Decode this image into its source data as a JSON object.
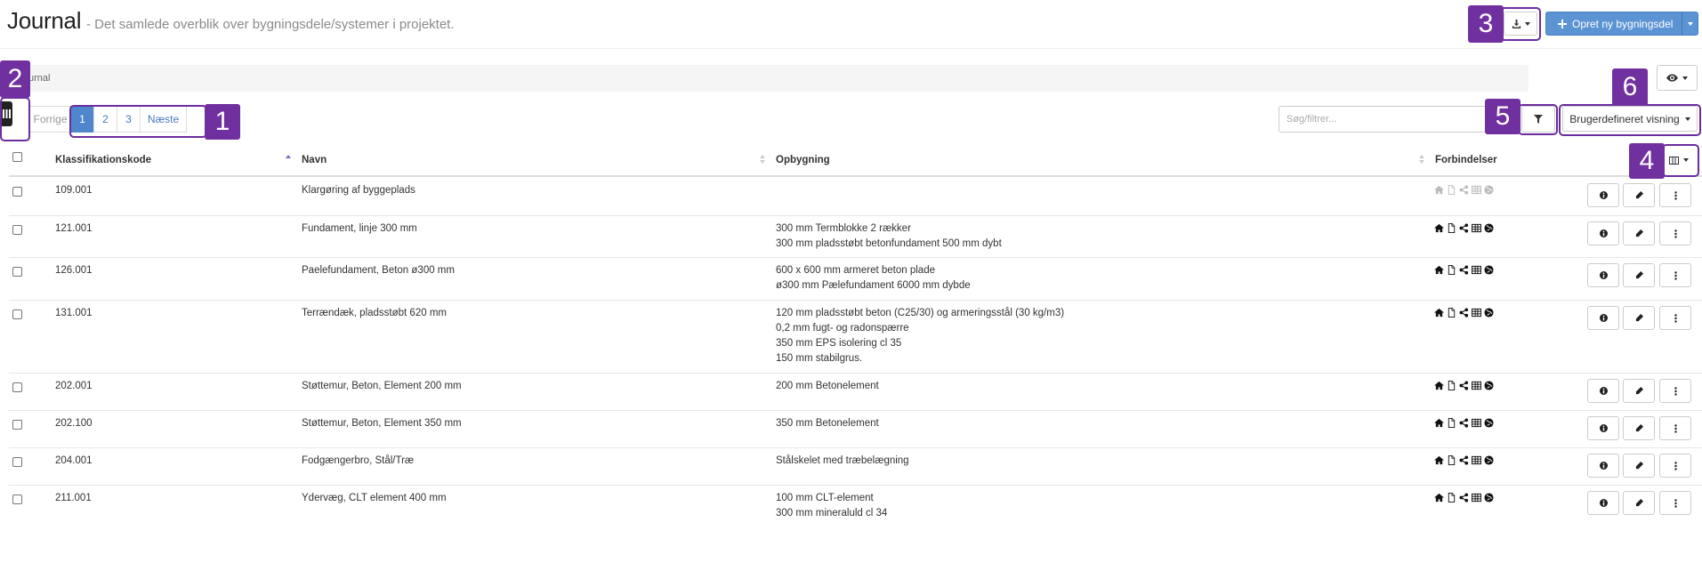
{
  "header": {
    "title": "Journal",
    "subtitle": "- Det samlede overblik over bygningsdele/systemer i projektet.",
    "create_button": "Opret ny bygningsdel"
  },
  "breadcrumb": {
    "text": "urnal"
  },
  "pagination": {
    "prev": "Forrige",
    "pages": [
      "1",
      "2",
      "3"
    ],
    "next": "Næste",
    "active_page": "1"
  },
  "search": {
    "placeholder": "Søg/filtrer..."
  },
  "view_select": {
    "label": "Brugerdefineret visning"
  },
  "table": {
    "columns": [
      "Klassifikationskode",
      "Navn",
      "Opbygning",
      "Forbindelser"
    ],
    "rows": [
      {
        "code": "109.001",
        "name": "Klargøring af byggeplads",
        "build": [],
        "faded": true
      },
      {
        "code": "121.001",
        "name": "Fundament, linje 300 mm",
        "build": [
          "300 mm Termblokke 2 rækker",
          "300 mm pladsstøbt betonfundament 500 mm dybt"
        ],
        "faded": false
      },
      {
        "code": "126.001",
        "name": "Paelefundament, Beton ø300 mm",
        "build": [
          "600 x 600 mm armeret beton plade",
          "ø300 mm Pælefundament 6000 mm dybde"
        ],
        "faded": false
      },
      {
        "code": "131.001",
        "name": "Terrændæk, pladsstøbt 620 mm",
        "build": [
          "120 mm pladsstøbt beton (C25/30) og armeringsstål (30 kg/m3)",
          "0,2 mm fugt- og radonspærre",
          "350 mm EPS isolering cl 35",
          "150 mm stabilgrus."
        ],
        "faded": false
      },
      {
        "code": "202.001",
        "name": "Støttemur, Beton, Element 200 mm",
        "build": [
          "200 mm Betonelement"
        ],
        "faded": false
      },
      {
        "code": "202.100",
        "name": "Støttemur, Beton, Element 350 mm",
        "build": [
          "350 mm Betonelement"
        ],
        "faded": false
      },
      {
        "code": "204.001",
        "name": "Fodgængerbro, Stål/Træ",
        "build": [
          "Stålskelet med træbelægning"
        ],
        "faded": false
      },
      {
        "code": "211.001",
        "name": "Ydervæg, CLT element 400 mm",
        "build": [
          "100 mm CLT-element",
          "300 mm mineraluld cl 34"
        ],
        "faded": false
      }
    ]
  },
  "annotations": [
    "1",
    "2",
    "3",
    "4",
    "5",
    "6"
  ],
  "colors": {
    "primary": "#5b93d3",
    "annotation": "#7030a0",
    "link": "#4a7ac0"
  },
  "icons": [
    "download-icon",
    "plus-icon",
    "eye-icon",
    "columns-icon",
    "filter-icon",
    "home-icon",
    "file-icon",
    "share-icon",
    "table-icon",
    "globe-icon",
    "info-icon",
    "pencil-icon",
    "more-vertical-icon"
  ]
}
